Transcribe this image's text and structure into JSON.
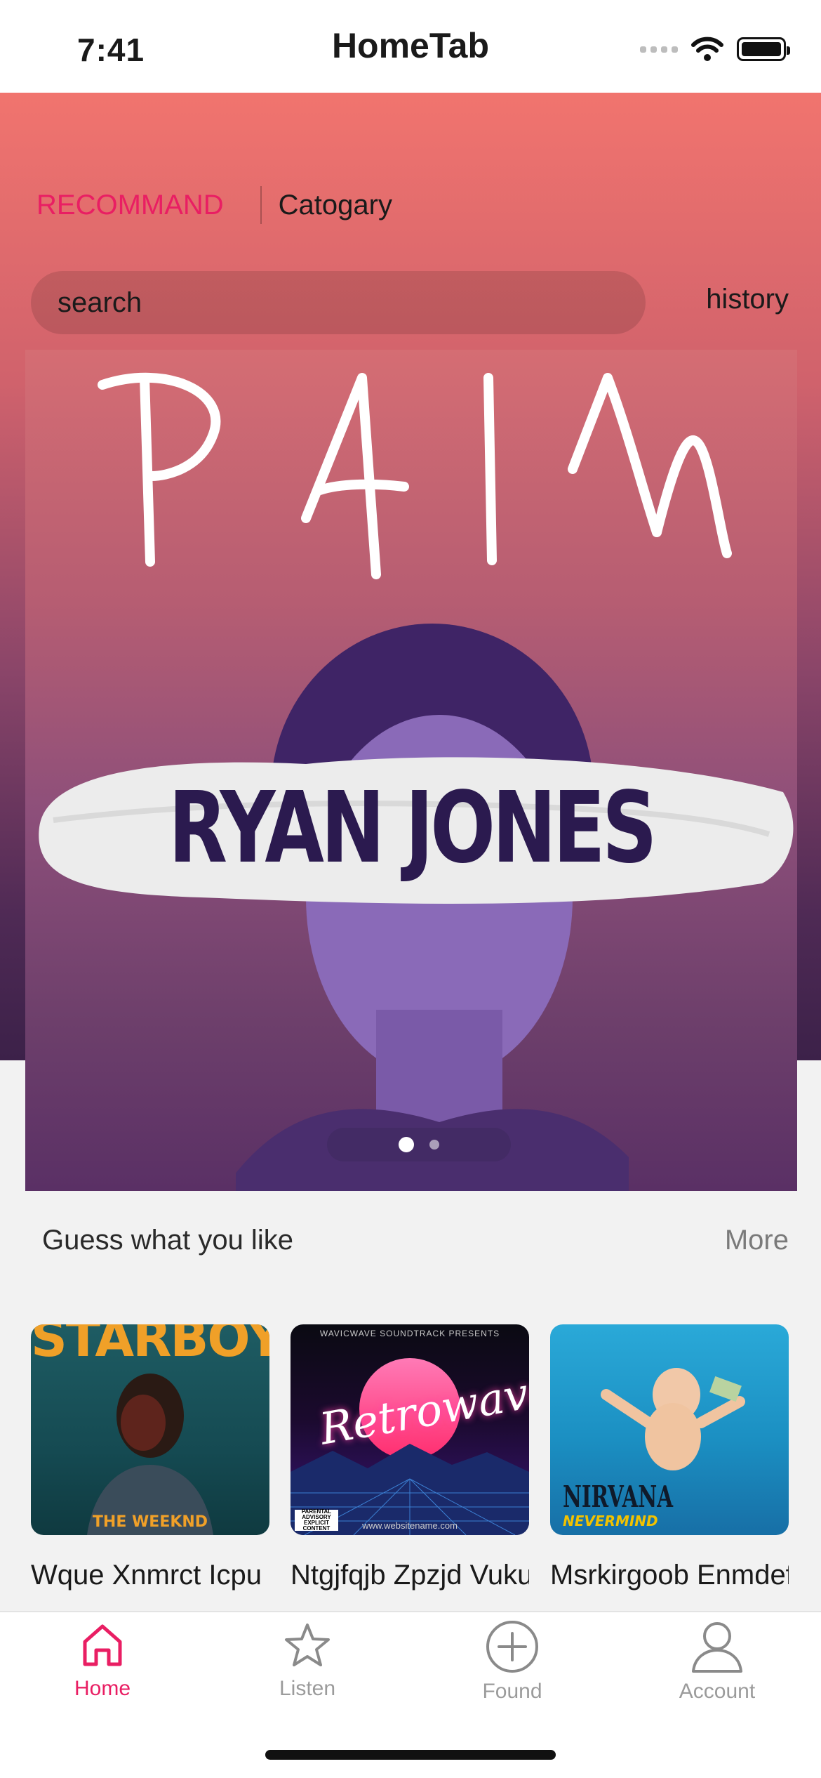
{
  "status_bar": {
    "time": "7:41",
    "title": "HomeTab"
  },
  "top_tabs": {
    "recommend": "RECOMMAND",
    "category": "Catogary"
  },
  "search": {
    "placeholder": "search",
    "history_label": "history"
  },
  "banner": {
    "title_text": "PAIN",
    "artist_text": "RYAN JONES",
    "page_count": 2,
    "active_page": 1
  },
  "section": {
    "title": "Guess what you like",
    "more_label": "More"
  },
  "albums": [
    {
      "title": "Wque Xnmrct Icpu Qiw",
      "cover": "starboy-cover",
      "cover_top_text": "STARBOY",
      "cover_bottom_text": "THE WEEKND"
    },
    {
      "title": "Ntgjfqjb Zpzjd Vukuiwnqw Kyc",
      "cover": "retrowave-cover",
      "cover_top_text": "WAVICWAVE SOUNDTRACK PRESENTS",
      "cover_script_text": "Retrowave",
      "cover_url_text": "www.websitename.com",
      "cover_advisory_text": "PARENTAL ADVISORY EXPLICIT CONTENT"
    },
    {
      "title": "Msrkirgoob Enmdefhk Qbsx",
      "cover": "nirvana-cover",
      "cover_top_text": "NIRVANA",
      "cover_bottom_text": "NEVERMIND"
    }
  ],
  "tab_bar": {
    "items": [
      {
        "label": "Home",
        "icon": "home-icon",
        "active": true
      },
      {
        "label": "Listen",
        "icon": "star-icon",
        "active": false
      },
      {
        "label": "Found",
        "icon": "plus-circle-icon",
        "active": false
      },
      {
        "label": "Account",
        "icon": "person-icon",
        "active": false
      }
    ]
  },
  "colors": {
    "accent": "#e91e63",
    "inactive": "#9b9b9b"
  }
}
